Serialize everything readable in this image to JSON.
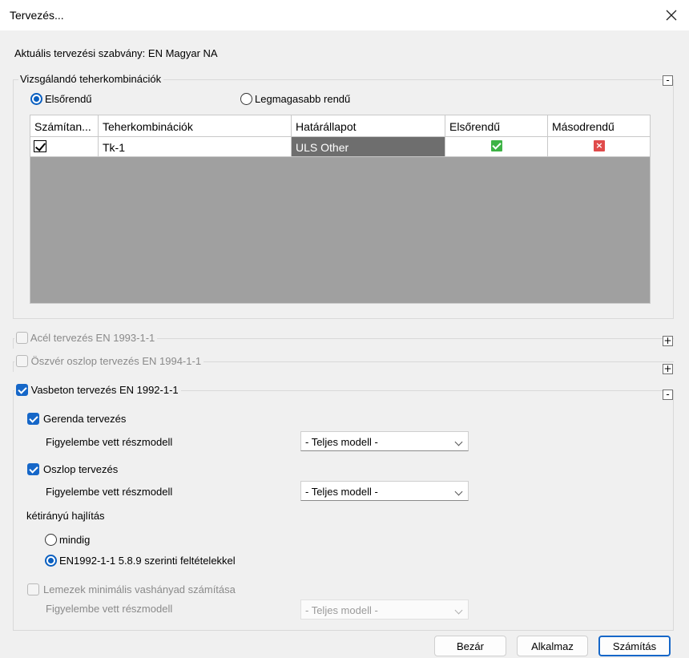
{
  "window": {
    "title": "Tervezés..."
  },
  "standard_label": "Aktuális tervezési szabvány: EN Magyar NA",
  "combos_group": {
    "title": "Vizsgálandó teherkombinációk",
    "collapse_symbol": "-",
    "radio_first": "Elsőrendű",
    "radio_highest": "Legmagasabb rendű",
    "selected_radio": "Elsőrendű",
    "grid": {
      "headers": [
        "Számítan...",
        "Teherkombinációk",
        "Határállapot",
        "Elsőrendű",
        "Másodrendű"
      ],
      "rows": [
        {
          "checked": true,
          "combo": "Tk-1",
          "limit_state": "ULS Other",
          "first_order": "check-icon",
          "second_order": "cross-icon"
        }
      ]
    }
  },
  "steel_group": {
    "title": "Acél tervezés EN 1993-1-1",
    "expand_symbol": "+",
    "checked": false
  },
  "composite_group": {
    "title": "Öszvér oszlop tervezés EN 1994-1-1",
    "expand_symbol": "+",
    "checked": false
  },
  "rc_group": {
    "title": "Vasbeton tervezés EN 1992-1-1",
    "collapse_symbol": "-",
    "checked": true,
    "beam": {
      "label": "Gerenda tervezés",
      "checked": true,
      "submodel_label": "Figyelembe vett részmodell",
      "submodel_value": "- Teljes modell -"
    },
    "column": {
      "label": "Oszlop tervezés",
      "checked": true,
      "submodel_label": "Figyelembe vett részmodell",
      "submodel_value": "- Teljes modell -"
    },
    "biaxial": {
      "label": "kétirányú hajlítás",
      "option_always": "mindig",
      "option_conditions": "EN1992-1-1 5.8.9 szerinti feltételekkel",
      "selected": "EN1992-1-1 5.8.9 szerinti feltételekkel"
    },
    "slab": {
      "label": "Lemezek minimális vashányad számítása",
      "checked": false,
      "submodel_label": "Figyelembe vett részmodell",
      "submodel_value": "- Teljes modell -"
    }
  },
  "buttons": {
    "close": "Bezár",
    "apply": "Alkalmaz",
    "calculate": "Számítás"
  },
  "colors": {
    "accent": "#1667c8",
    "selected_cell": "#6e6e6e",
    "ok": "#3db345",
    "error": "#e04b4b",
    "grid_empty": "#a0a0a0"
  }
}
